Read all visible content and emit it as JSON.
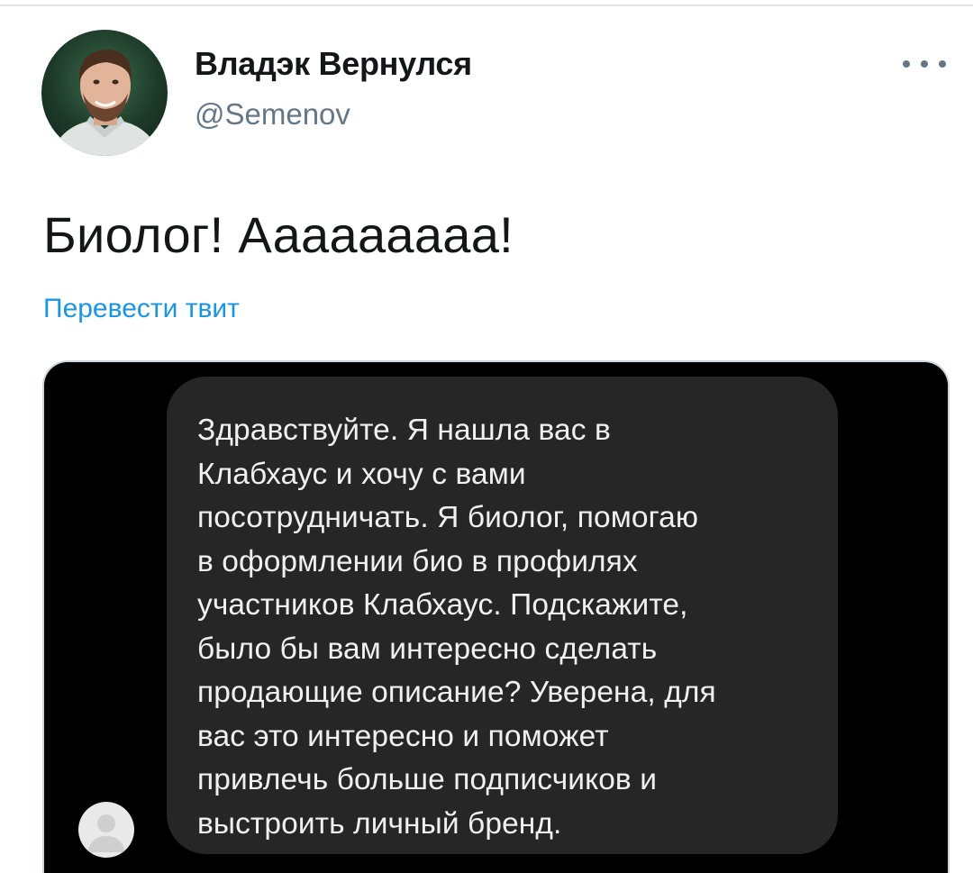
{
  "tweet": {
    "author": {
      "display_name": "Владэк Вернулся",
      "handle": "@Semenov"
    },
    "text": "Биолог! Ааааааааа!",
    "translate_label": "Перевести твит",
    "more_icon": "more-horizontal-icon"
  },
  "media": {
    "message_lines": [
      "Здравствуйте. Я нашла вас в",
      "Клабхаус и хочу с вами",
      "посотрудничать. Я биолог, помогаю",
      "в оформлении био в профилях",
      "участников Клабхаус. Подскажите,",
      "было бы вам интересно сделать",
      "продающие описание? Уверена, для",
      "вас это интересно и поможет",
      "привлечь больше подписчиков и",
      "выстроить личный бренд."
    ]
  },
  "colors": {
    "text_primary": "#14171a",
    "text_secondary": "#657786",
    "link": "#1b95e0",
    "bubble": "#262626",
    "media_bg": "#000000"
  }
}
